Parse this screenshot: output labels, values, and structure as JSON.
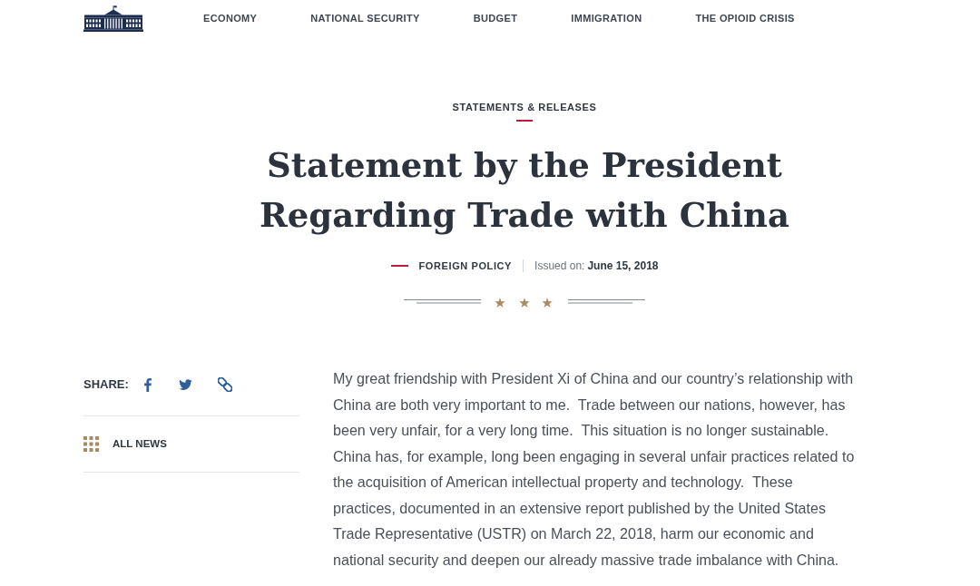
{
  "nav": {
    "links": [
      "ECONOMY",
      "NATIONAL SECURITY",
      "BUDGET",
      "IMMIGRATION",
      "THE OPIOID CRISIS"
    ]
  },
  "article": {
    "category": "STATEMENTS & RELEASES",
    "title": "Statement by the President Regarding Trade with China",
    "topic": "FOREIGN POLICY",
    "issued_label": "Issued on:",
    "issued_date": "June 15, 2018"
  },
  "sidebar": {
    "share_label": "SHARE:",
    "all_news": "ALL NEWS"
  },
  "body": {
    "paragraphs": [
      "My great friendship with President Xi of China and our country’s relationship with China are both very important to me.  Trade between our nations, however, has been very unfair, for a very long time.  This situation is no longer sustainable.  China has, for example, long been engaging in several unfair practices related to the acquisition of American intellectual property and technology.  These practices, documented in an extensive report published by the United States Trade Representative (USTR) on March 22, 2018, harm our economic and national security and deepen our already massive trade imbalance with China."
    ]
  }
}
